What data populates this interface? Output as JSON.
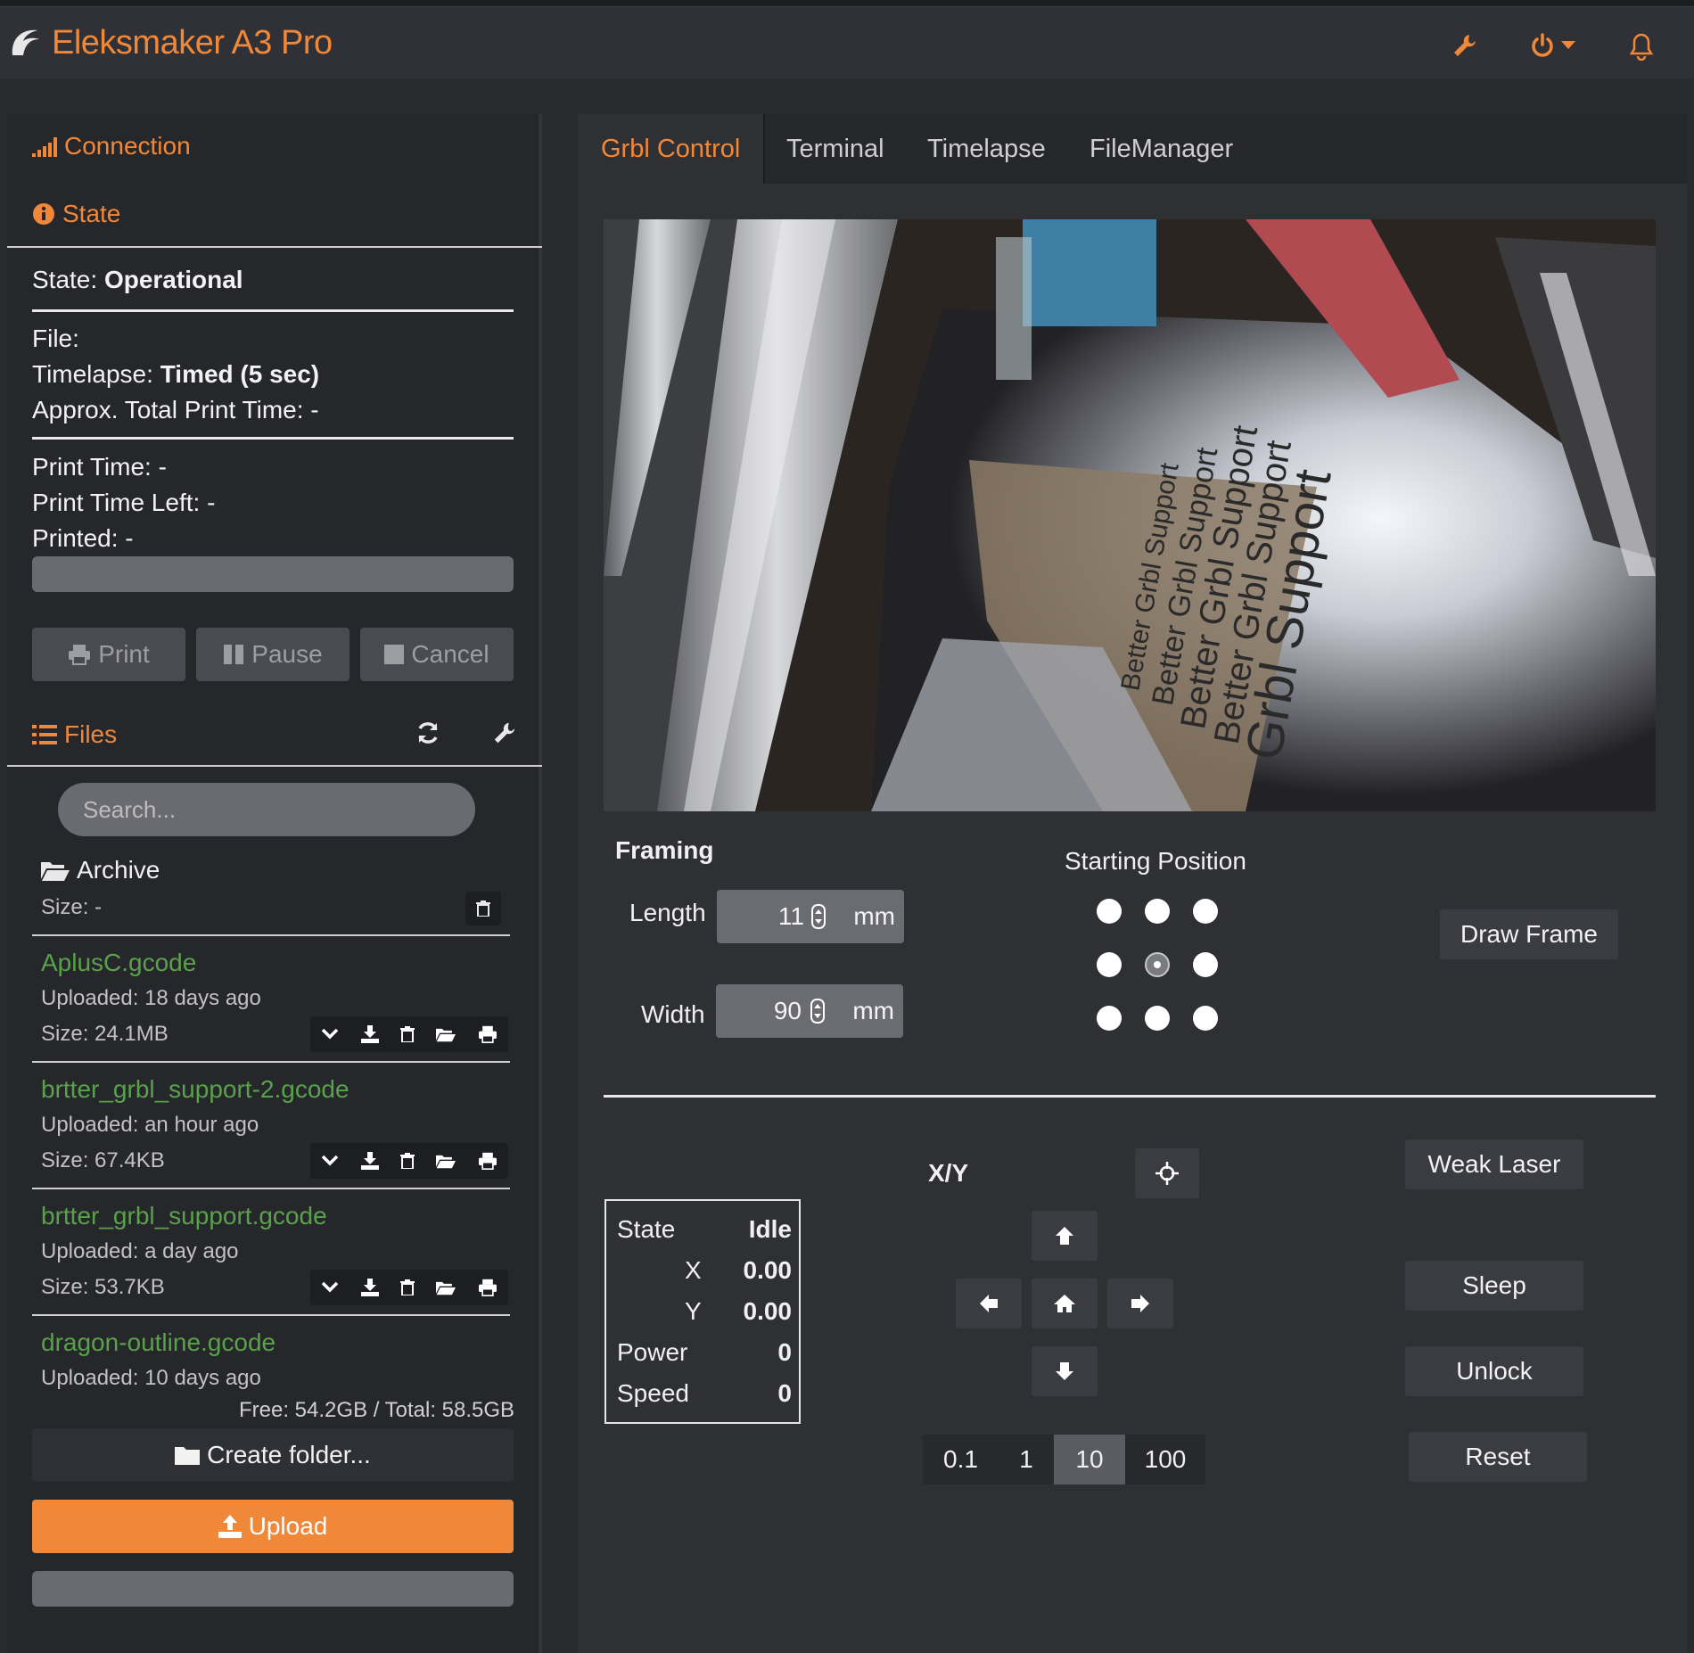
{
  "app": {
    "title": "Eleksmaker A3 Pro",
    "accent": "#f0883a"
  },
  "sidebar": {
    "connection_label": "Connection",
    "state_label": "State",
    "state_prefix": "State:",
    "state_value": "Operational",
    "file_label": "File:",
    "timelapse_prefix": "Timelapse:",
    "timelapse_value": "Timed (5 sec)",
    "approx_label": "Approx. Total Print Time: -",
    "print_time": "Print Time: -",
    "print_time_left": "Print Time Left: -",
    "printed": "Printed: -",
    "print_btn": "Print",
    "pause_btn": "Pause",
    "cancel_btn": "Cancel",
    "files_label": "Files",
    "search_placeholder": "Search...",
    "folder": {
      "name": "Archive",
      "size": "Size: -"
    },
    "files": [
      {
        "name": "AplusC.gcode",
        "uploaded": "Uploaded: 18 days ago",
        "size": "Size: 24.1MB"
      },
      {
        "name": "brtter_grbl_support-2.gcode",
        "uploaded": "Uploaded: an hour ago",
        "size": "Size: 67.4KB"
      },
      {
        "name": "brtter_grbl_support.gcode",
        "uploaded": "Uploaded: a day ago",
        "size": "Size: 53.7KB"
      },
      {
        "name": "dragon-outline.gcode",
        "uploaded": "Uploaded: 10 days ago"
      }
    ],
    "storage": "Free: 54.2GB / Total: 58.5GB",
    "create_folder": "Create folder...",
    "upload": "Upload"
  },
  "tabs": [
    "Grbl Control",
    "Terminal",
    "Timelapse",
    "FileManager"
  ],
  "framing": {
    "title": "Framing",
    "length_label": "Length",
    "length_value": "11",
    "width_label": "Width",
    "width_value": "90",
    "unit": "mm",
    "starting_position_label": "Starting Position",
    "draw_frame": "Draw Frame"
  },
  "camera_text": [
    "Better Grbl Support",
    "Better Grbl Support",
    "Better Grbl Support",
    "Better Grbl Support",
    "Grbl Support"
  ],
  "control": {
    "xy_label": "X/Y",
    "status": [
      {
        "k": "State",
        "v": "Idle"
      },
      {
        "k": "X",
        "v": "0.00"
      },
      {
        "k": "Y",
        "v": "0.00"
      },
      {
        "k": "Power",
        "v": "0"
      },
      {
        "k": "Speed",
        "v": "0"
      }
    ],
    "steps": [
      "0.1",
      "1",
      "10",
      "100"
    ],
    "active_step": "10",
    "weak_laser": "Weak Laser",
    "sleep": "Sleep",
    "unlock": "Unlock",
    "reset": "Reset"
  }
}
